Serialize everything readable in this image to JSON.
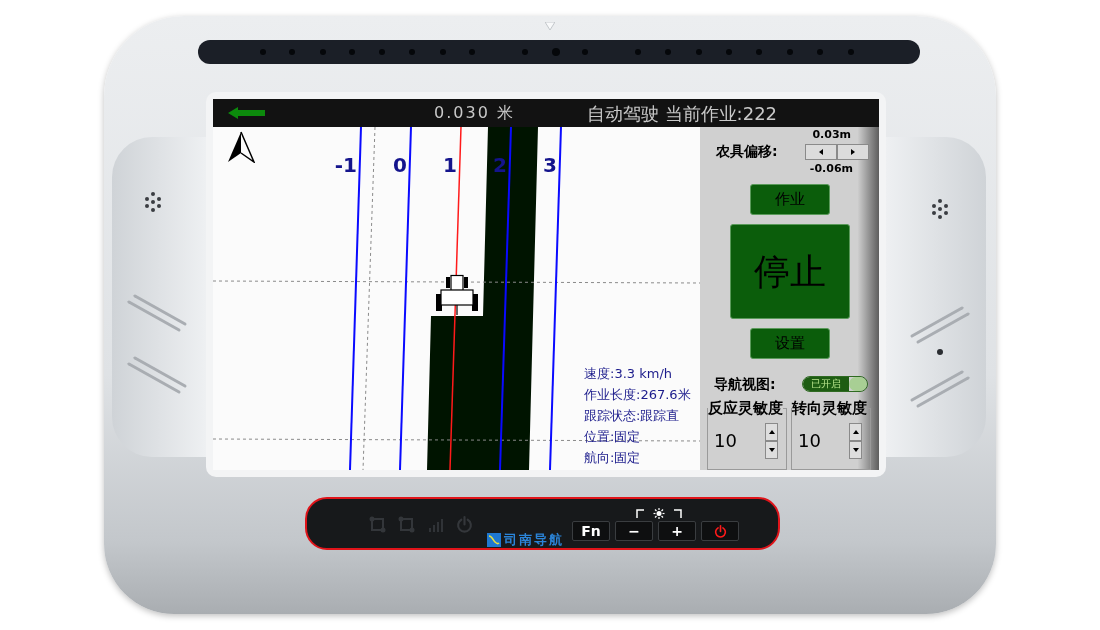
{
  "top_bar": {
    "offset": "0.030 米",
    "status": "自动驾驶 当前作业:222"
  },
  "map": {
    "lanes": [
      {
        "label": "-1",
        "selected": false
      },
      {
        "label": "0",
        "selected": false
      },
      {
        "label": "1",
        "selected": true
      },
      {
        "label": "2",
        "selected": false
      },
      {
        "label": "3",
        "selected": false
      }
    ],
    "info": [
      "速度:3.3 km/h",
      "作业长度:267.6米",
      "跟踪状态:跟踪直",
      "位置:固定",
      "航向:固定"
    ]
  },
  "implement_offset": {
    "upper_value": "0.03m",
    "label": "农具偏移:",
    "lower_value": "-0.06m"
  },
  "actions": [
    {
      "label": "作业",
      "kind": "small"
    },
    {
      "label": "停止",
      "kind": "large"
    },
    {
      "label": "设置",
      "kind": "small"
    }
  ],
  "nav_view": {
    "label": "导航视图:",
    "toggle_text": "已开启",
    "on": true
  },
  "sensitivity": [
    {
      "label": "反应灵敏度",
      "value": "10"
    },
    {
      "label": "转向灵敏度",
      "value": "10"
    }
  ],
  "device_keys": {
    "brand": "司南导航",
    "keys": [
      {
        "kind": "text",
        "label": "Fn"
      },
      {
        "kind": "text",
        "label": "−"
      },
      {
        "kind": "text",
        "label": "+"
      },
      {
        "kind": "power"
      }
    ]
  }
}
